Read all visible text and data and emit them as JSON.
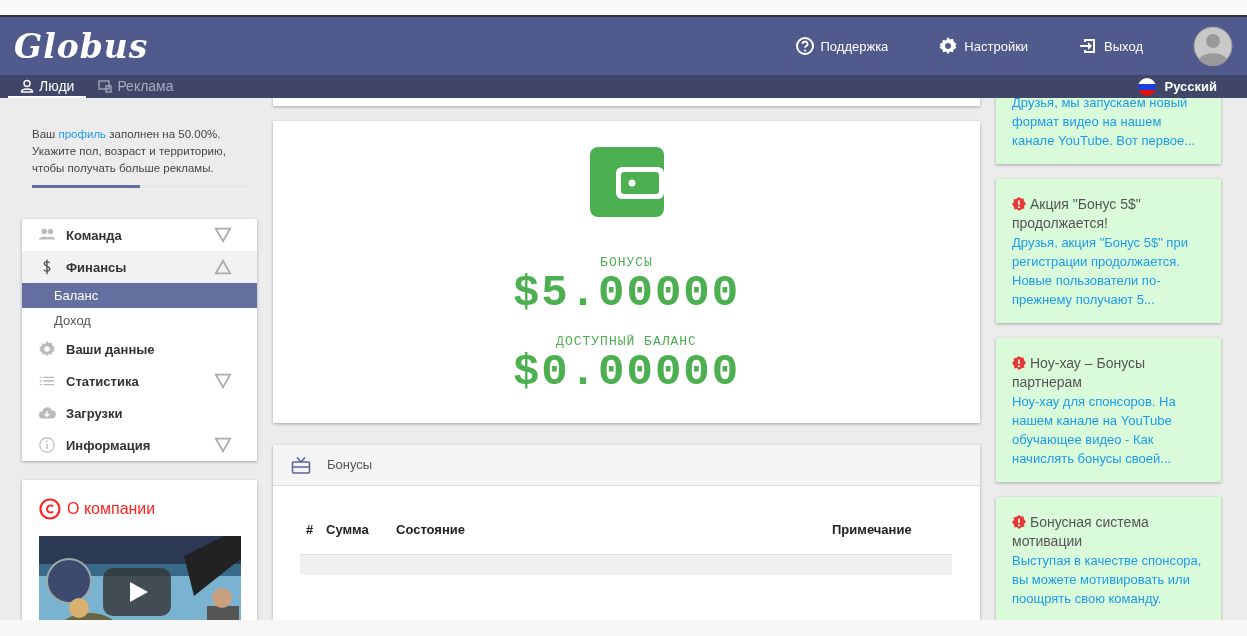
{
  "header": {
    "logo": "Globus",
    "actions": [
      {
        "kind": "support",
        "label": "Поддержка"
      },
      {
        "kind": "settings",
        "label": "Настройки"
      },
      {
        "kind": "logout",
        "label": "Выход"
      }
    ]
  },
  "subnav": {
    "tabs": [
      {
        "kind": "people",
        "label": "Люди",
        "selected": true
      },
      {
        "kind": "ads",
        "label": "Реклама",
        "selected": false
      }
    ],
    "language": "Русский"
  },
  "profile": {
    "before": "Ваш ",
    "link": "профиль",
    "after": " заполнен на 50.00%. Укажите пол, возраст и территорию, чтобы получать больше рекламы.",
    "level": 0.5
  },
  "menu": [
    {
      "kind": "team",
      "label": "Команда",
      "expandable": true,
      "expanded": false
    },
    {
      "kind": "dollar",
      "label": "Финансы",
      "expandable": true,
      "expanded": true,
      "children": [
        {
          "label": "Баланс",
          "selected": true
        },
        {
          "label": "Доход",
          "selected": false
        }
      ]
    },
    {
      "kind": "gear",
      "label": "Ваши данные",
      "expandable": false,
      "expanded": false
    },
    {
      "kind": "list",
      "label": "Статистика",
      "expandable": true,
      "expanded": false
    },
    {
      "kind": "cloud",
      "label": "Загрузки",
      "expandable": false,
      "expanded": false
    },
    {
      "kind": "info",
      "label": "Информация",
      "expandable": true,
      "expanded": false
    }
  ],
  "about": {
    "title": "О компании"
  },
  "wallet": {
    "items": [
      {
        "label": "БОНУСЫ",
        "value": "$5.00000"
      },
      {
        "label": "ДОСТУПНЫЙ БАЛАНС",
        "value": "$0.00000"
      }
    ]
  },
  "bonuses": {
    "title": "Бонусы",
    "table": {
      "columns": [
        "#",
        "Сумма",
        "Состояние",
        "Примечание"
      ]
    }
  },
  "news": [
    {
      "body": "Друзья, мы запускаем новый формат видео на нашем канале YouTube. Вот первое..."
    },
    {
      "title": "Акция \"Бонус 5$\" продолжается!",
      "body": "Друзья, акция \"Бонус 5$\" при регистрации продолжается. Новые пользователи по-прежнему получают 5..."
    },
    {
      "title": "Ноу-хау – Бонусы партнерам",
      "body": "Ноу-хау для спонсоров. На нашем канале на YouTube обучающее видео - Как начислять бонусы своей..."
    },
    {
      "title": "Бонусная система мотивации",
      "body": "Выступая в качестве спонсора, вы можете мотивировать или поощрять свою команду."
    }
  ]
}
